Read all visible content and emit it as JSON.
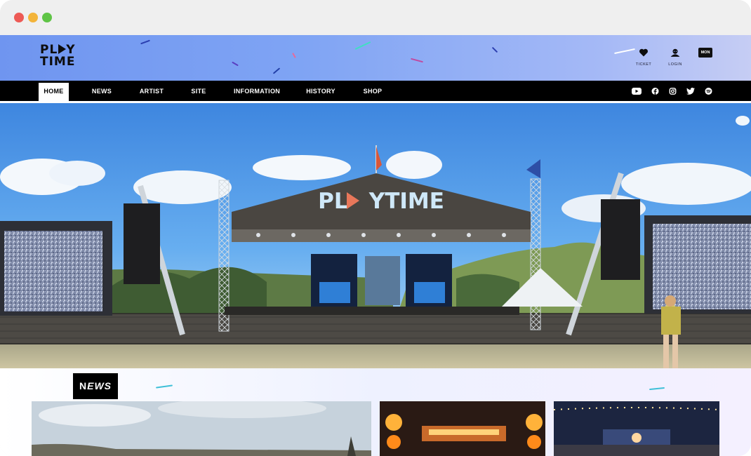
{
  "brand": {
    "logo_line1": "PL",
    "logo_line1_end": "Y",
    "logo_line2": "TIME"
  },
  "header": {
    "ticket_label": "TICKET",
    "login_label": "LOGIN",
    "lang_badge": "MON"
  },
  "nav": {
    "items": [
      {
        "label": "HOME",
        "active": true
      },
      {
        "label": "NEWS"
      },
      {
        "label": "ARTIST"
      },
      {
        "label": "SITE"
      },
      {
        "label": "INFORMATION"
      },
      {
        "label": "HISTORY"
      },
      {
        "label": "SHOP"
      }
    ],
    "social": [
      "youtube-icon",
      "facebook-icon",
      "instagram-icon",
      "twitter-icon",
      "spotify-icon"
    ]
  },
  "hero": {
    "stage_banner": "PL",
    "stage_banner_end": "YTIME"
  },
  "news": {
    "heading_first": "N",
    "heading_rest": "EWS"
  },
  "colors": {
    "nav_bg": "#000000",
    "header_gradient_start": "#6f95f0",
    "accent_play": "#e8775a"
  }
}
